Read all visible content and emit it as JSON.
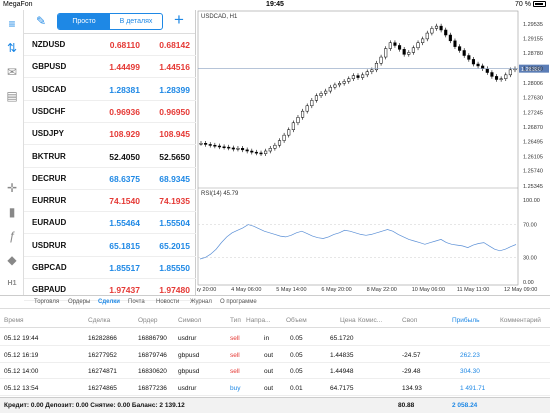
{
  "status_bar": {
    "carrier": "MegaFon",
    "time": "19:45",
    "battery": "70 %"
  },
  "quotes": {
    "tab_simple": "Просто",
    "tab_detailed": "В деталях",
    "rows": [
      {
        "symbol": "NZDUSD",
        "bid": "0.68110",
        "ask": "0.68142",
        "color": "red"
      },
      {
        "symbol": "GBPUSD",
        "bid": "1.44499",
        "ask": "1.44516",
        "color": "red"
      },
      {
        "symbol": "USDCAD",
        "bid": "1.28381",
        "ask": "1.28399",
        "color": "blue"
      },
      {
        "symbol": "USDCHF",
        "bid": "0.96936",
        "ask": "0.96950",
        "color": "red"
      },
      {
        "symbol": "USDJPY",
        "bid": "108.929",
        "ask": "108.945",
        "color": "red"
      },
      {
        "symbol": "BKTRUR",
        "bid": "52.4050",
        "ask": "52.5650",
        "color": "black"
      },
      {
        "symbol": "DECRUR",
        "bid": "68.6375",
        "ask": "68.9345",
        "color": "blue"
      },
      {
        "symbol": "EURRUR",
        "bid": "74.1540",
        "ask": "74.1935",
        "color": "red"
      },
      {
        "symbol": "EURAUD",
        "bid": "1.55464",
        "ask": "1.55504",
        "color": "blue"
      },
      {
        "symbol": "USDRUR",
        "bid": "65.1815",
        "ask": "65.2015",
        "color": "blue"
      },
      {
        "symbol": "GBPCAD",
        "bid": "1.85517",
        "ask": "1.85550",
        "color": "blue"
      },
      {
        "symbol": "GBPAUD",
        "bid": "1.97437",
        "ask": "1.97480",
        "color": "red"
      }
    ]
  },
  "chart": {
    "title": "USDCAD, H1",
    "rsi_label": "RSI(14) 45.79",
    "price_ticks": [
      "1.29535",
      "1.29155",
      "1.28780",
      "1.28380",
      "1.28006",
      "1.27630",
      "1.27245",
      "1.26870",
      "1.26495",
      "1.26105",
      "1.25740",
      "1.25345"
    ],
    "current_price": "1.28380",
    "rsi_ticks": [
      "100.00",
      "70.00",
      "30.00",
      "0.00"
    ],
    "x_ticks": [
      "2 May 20:00",
      "4 May 06:00",
      "5 May 14:00",
      "6 May 20:00",
      "8 May 22:00",
      "10 May 06:00",
      "11 May 11:00",
      "12 May 09:00"
    ]
  },
  "chart_data": {
    "type": "line",
    "title": "USDCAD, H1",
    "series": [
      {
        "values": [
          1.2645,
          1.2642,
          1.264,
          1.2638,
          1.2636,
          1.2635,
          1.2633,
          1.263,
          1.2632,
          1.2628,
          1.2625,
          1.2622,
          1.262,
          1.2618,
          1.2625,
          1.2632,
          1.264,
          1.2652,
          1.2666,
          1.268,
          1.2698,
          1.2712,
          1.2728,
          1.2742,
          1.2756,
          1.2768,
          1.2774,
          1.278,
          1.279,
          1.2796,
          1.28,
          1.2805,
          1.2812,
          1.282,
          1.2815,
          1.2822,
          1.283,
          1.2835,
          1.2852,
          1.2868,
          1.289,
          1.2905,
          1.2898,
          1.2888,
          1.2875,
          1.288,
          1.2892,
          1.2905,
          1.2915,
          1.293,
          1.2942,
          1.2948,
          1.2938,
          1.2925,
          1.291,
          1.2895,
          1.2885,
          1.2872,
          1.2862,
          1.285,
          1.2845,
          1.2838,
          1.2828,
          1.2818,
          1.281,
          1.2812,
          1.2822,
          1.2835,
          1.2838
        ]
      }
    ],
    "rsi_values": [
      28,
      30,
      34,
      40,
      48,
      55,
      60,
      63,
      66,
      70,
      68,
      65,
      62,
      60,
      58,
      56,
      55,
      57,
      60,
      62,
      59,
      56,
      54,
      53,
      55,
      58,
      60,
      63,
      62,
      60,
      58,
      57,
      58,
      60,
      62,
      64,
      62,
      58,
      55,
      52,
      50,
      48,
      46,
      48,
      50,
      52,
      48,
      46,
      45,
      44,
      42,
      45,
      47,
      48,
      44,
      40,
      38,
      40,
      43,
      45.79
    ],
    "ylim": [
      1.25345,
      1.29535
    ],
    "rsi_ylim": [
      0,
      100
    ]
  },
  "bottom_tabs": [
    "Торговля",
    "Ордеры",
    "Сделки",
    "Почта",
    "Новости",
    "Журнал",
    "О программе"
  ],
  "deals": {
    "headers": [
      "Время",
      "Сделка",
      "Ордер",
      "Символ",
      "Тип",
      "Напра...",
      "Объем",
      "Цена",
      "Комис...",
      "Своп",
      "Прибыль",
      "Комментарий"
    ],
    "rows": [
      {
        "time": "05.12 19:44",
        "deal": "16282866",
        "order": "16886790",
        "symbol": "usdrur",
        "type": "sell",
        "dir": "in",
        "volume": "0.05",
        "price": "65.1720",
        "commission": "",
        "swap": "",
        "profit": ""
      },
      {
        "time": "05.12 16:19",
        "deal": "16277952",
        "order": "16879746",
        "symbol": "gbpusd",
        "type": "sell",
        "dir": "out",
        "volume": "0.05",
        "price": "1.44835",
        "commission": "",
        "swap": "-24.57",
        "profit": "262.23"
      },
      {
        "time": "05.12 14:00",
        "deal": "16274871",
        "order": "16830620",
        "symbol": "gbpusd",
        "type": "sell",
        "dir": "out",
        "volume": "0.05",
        "price": "1.44948",
        "commission": "",
        "swap": "-29.48",
        "profit": "304.30"
      },
      {
        "time": "05.12 13:54",
        "deal": "16274865",
        "order": "16877236",
        "symbol": "usdrur",
        "type": "buy",
        "dir": "out",
        "volume": "0.01",
        "price": "64.7175",
        "commission": "",
        "swap": "134.93",
        "profit": "1 491.71"
      }
    ]
  },
  "summary": {
    "text": "Кредит: 0.00 Депозит: 0.00 Снятие: 0.00 Баланс: 2 139.12",
    "swap": "80.88",
    "profit": "2 058.24"
  }
}
